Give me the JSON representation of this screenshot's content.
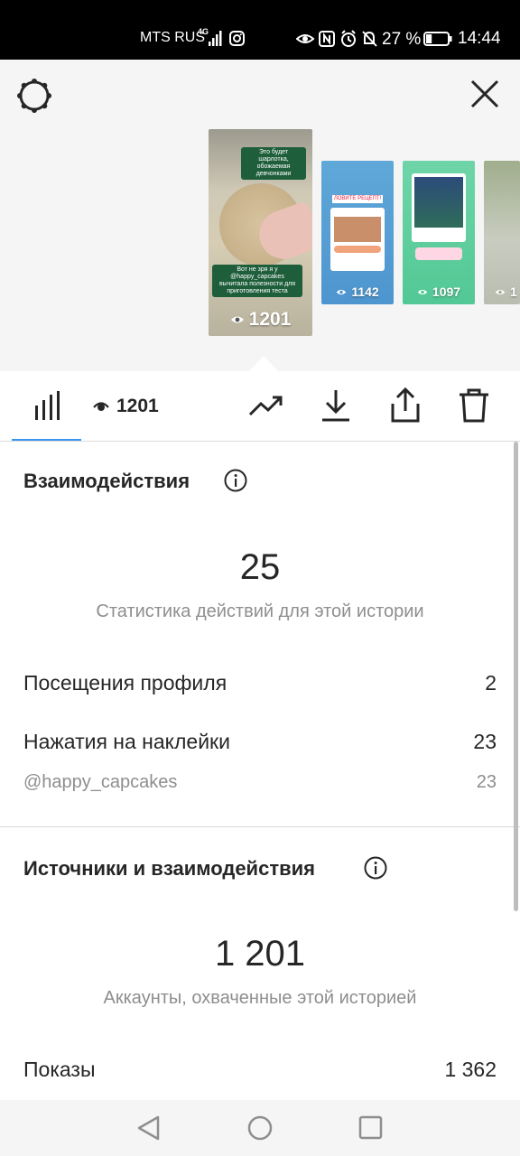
{
  "status_bar": {
    "carrier": "MTS RUS",
    "network": "4G",
    "battery_percent": "27 %",
    "time": "14:44",
    "battery_level": 0.27
  },
  "header": {
    "settings_icon": "gear-icon",
    "close_icon": "close-icon"
  },
  "stories": [
    {
      "views": "1201",
      "tag_top": "Это будет шарлотка, обожаемая девчонками",
      "tag_bottom": "Вот не зря я у @happy_capcakes вычитала полезности для приготовления теста"
    },
    {
      "views": "1142",
      "tag": "ЛОВИТЕ РЕЦЕПТ!",
      "card_label": "BOUNTY"
    },
    {
      "views": "1097",
      "tag": "URAMAN",
      "question": "А какую суперспособность выбрали бы вы?"
    },
    {
      "views": "1"
    }
  ],
  "toolbar": {
    "views_count": "1201",
    "icons": [
      "insights-bars-icon",
      "eye-icon",
      "trend-arrow-icon",
      "download-icon",
      "share-icon",
      "trash-icon"
    ]
  },
  "interactions": {
    "title": "Взаимодействия",
    "total": "25",
    "subtitle": "Статистика действий для этой истории",
    "rows": [
      {
        "label": "Посещения профиля",
        "value": "2"
      },
      {
        "label": "Нажатия на наклейки",
        "value": "23"
      },
      {
        "label": "@happy_capcakes",
        "value": "23"
      }
    ]
  },
  "discovery": {
    "title": "Источники и взаимодействия",
    "total": "1 201",
    "subtitle": "Аккаунты, охваченные этой историей",
    "rows": [
      {
        "label": "Показы",
        "value": "1 362"
      }
    ]
  },
  "colors": {
    "accent": "#3897f0",
    "text": "#262626",
    "muted": "#8e8e8e"
  }
}
